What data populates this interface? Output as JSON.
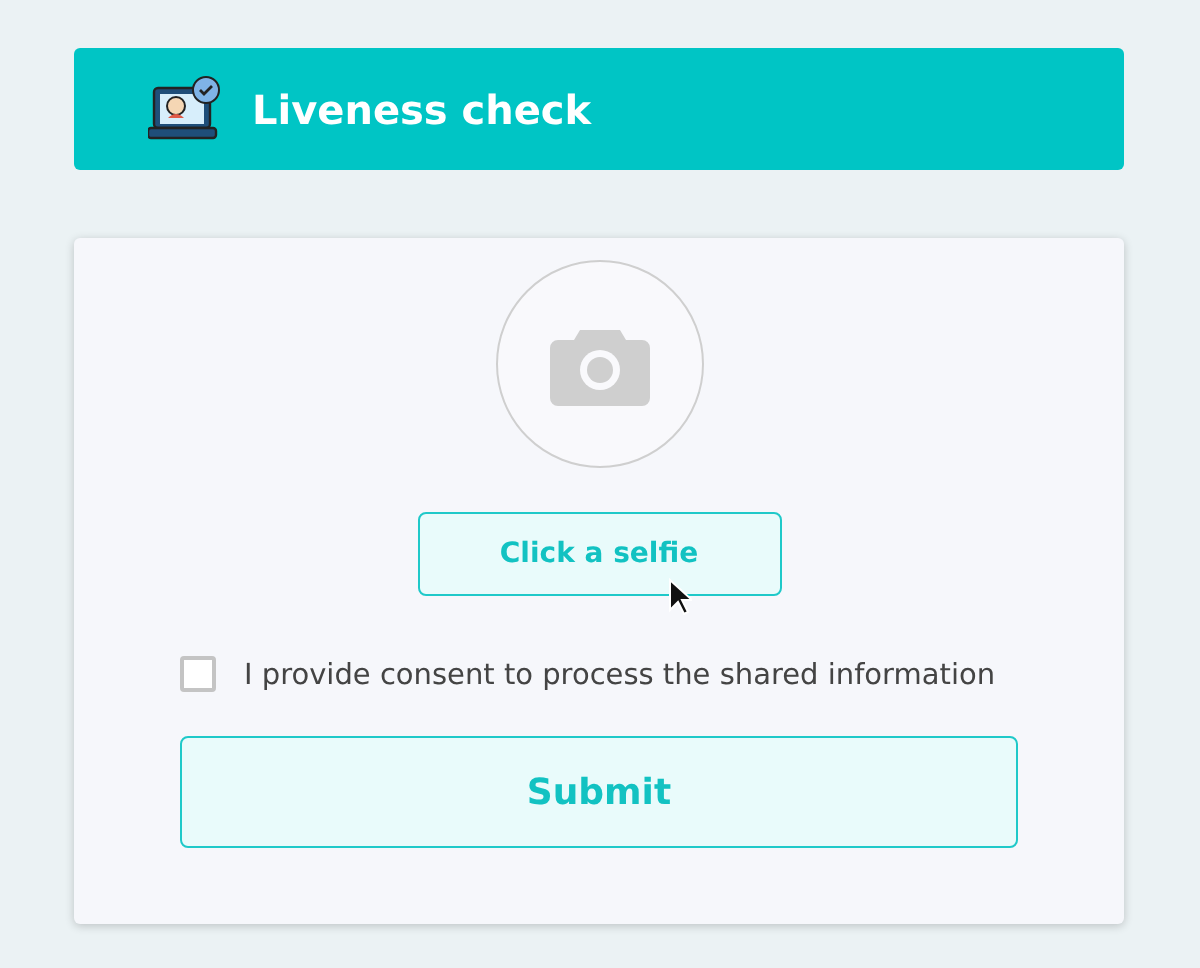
{
  "header": {
    "title": "Liveness check"
  },
  "selfie": {
    "button": "Click a selfie"
  },
  "consent": {
    "label": "I provide consent to process the shared information",
    "checked": false
  },
  "submit": {
    "label": "Submit"
  }
}
